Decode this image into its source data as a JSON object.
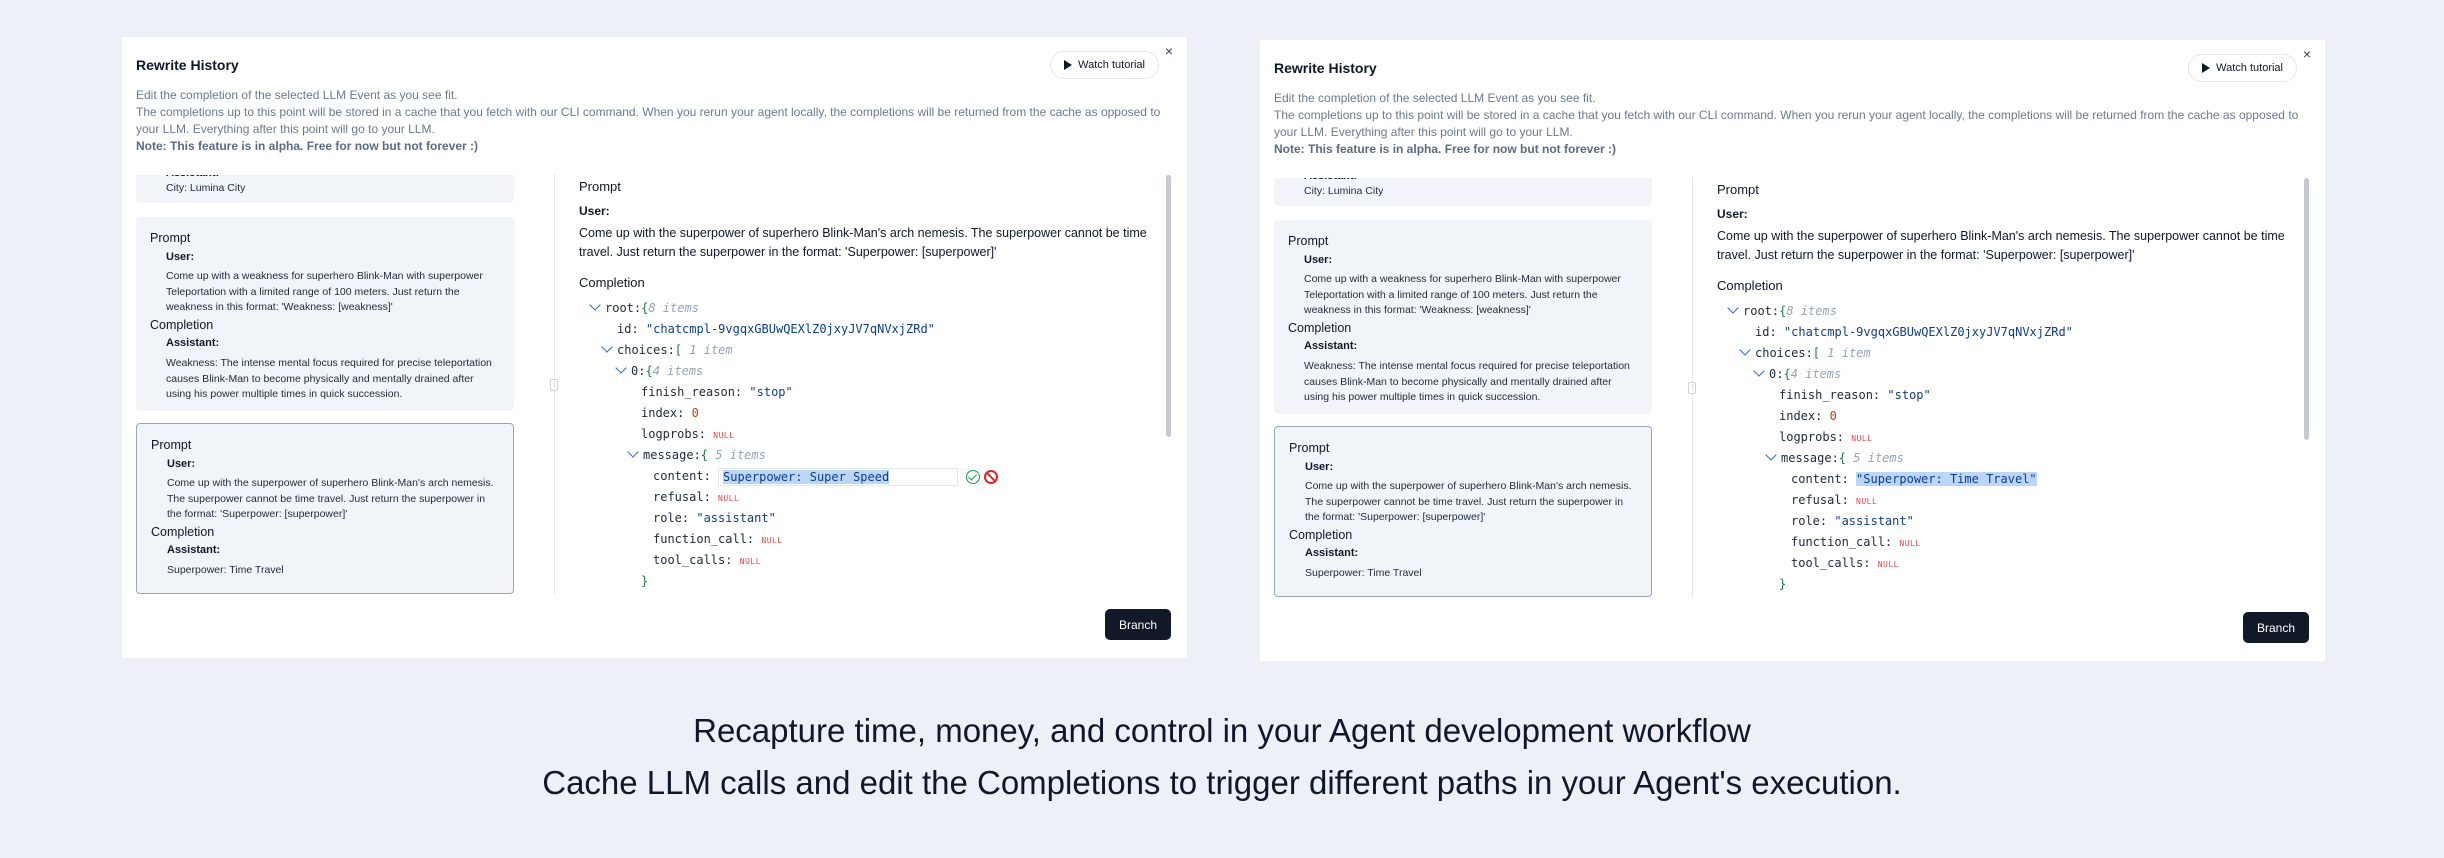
{
  "panels": [
    {
      "title": "Rewrite History",
      "tutorial_label": "Watch tutorial",
      "close_label": "×",
      "desc_line1": "Edit the completion of the selected LLM Event as you see fit.",
      "desc_line2": "The completions up to this point will be stored in a cache that you fetch with our CLI command. When you rerun your agent locally, the completions will be returned from the cache as opposed to your LLM. Everything after this point will go to your LLM.",
      "note": "Note: This feature is in alpha. Free for now but not forever :)",
      "events": {
        "ev0_role": "Assistant:",
        "ev0_text": "City: Lumina City",
        "ev1_prompt": "Prompt",
        "ev1_user": "User:",
        "ev1_user_text": "Come up with a weakness for superhero Blink-Man with superpower Teleportation with a limited range of 100 meters. Just return the weakness in this format: 'Weakness: [weakness]'",
        "ev1_completion": "Completion",
        "ev1_assistant": "Assistant:",
        "ev1_assistant_text": "Weakness: The intense mental focus required for precise teleportation causes Blink-Man to become physically and mentally drained after using his power multiple times in quick succession.",
        "ev2_prompt": "Prompt",
        "ev2_user": "User:",
        "ev2_user_text": "Come up with the superpower of superhero Blink-Man's arch nemesis. The superpower cannot be time travel. Just return the superpower in the format: 'Superpower: [superpower]'",
        "ev2_completion": "Completion",
        "ev2_assistant": "Assistant:",
        "ev2_assistant_text": "Superpower: Time Travel"
      },
      "detail": {
        "prompt_label": "Prompt",
        "user_label": "User:",
        "user_text": "Come up with the superpower of superhero Blink-Man's arch nemesis. The superpower cannot be time travel. Just return the superpower in the format: 'Superpower: [superpower]'",
        "completion_label": "Completion",
        "json": {
          "root": "root:",
          "root_count": "8 items",
          "id_key": "id:",
          "id_val": "\"chatcmpl-9vgqxGBUwQEXlZ0jxyJV7qNVxjZRd\"",
          "choices_key": "choices:",
          "choices_count": "1 item",
          "zero_key": "0:",
          "zero_count": "4 items",
          "finish_key": "finish_reason:",
          "finish_val": "\"stop\"",
          "index_key": "index:",
          "index_val": "0",
          "logprobs_key": "logprobs:",
          "null_label": "NULL",
          "message_key": "message:",
          "message_count": "5 items",
          "content_key": "content:",
          "content_val": "Superpower: Super Speed",
          "refusal_key": "refusal:",
          "role_key": "role:",
          "role_val": "\"assistant\"",
          "function_call_key": "function_call:",
          "tool_calls_key": "tool_calls:",
          "open_brace": "{",
          "open_bracket": "[",
          "close_brace": "}"
        }
      },
      "branch_label": "Branch"
    },
    {
      "title": "Rewrite History",
      "tutorial_label": "Watch tutorial",
      "close_label": "×",
      "desc_line1": "Edit the completion of the selected LLM Event as you see fit.",
      "desc_line2": "The completions up to this point will be stored in a cache that you fetch with our CLI command. When you rerun your agent locally, the completions will be returned from the cache as opposed to your LLM. Everything after this point will go to your LLM.",
      "note": "Note: This feature is in alpha. Free for now but not forever :)",
      "events": {
        "ev0_role": "Assistant:",
        "ev0_text": "City: Lumina City",
        "ev1_prompt": "Prompt",
        "ev1_user": "User:",
        "ev1_user_text": "Come up with a weakness for superhero Blink-Man with superpower Teleportation with a limited range of 100 meters. Just return the weakness in this format: 'Weakness: [weakness]'",
        "ev1_completion": "Completion",
        "ev1_assistant": "Assistant:",
        "ev1_assistant_text": "Weakness: The intense mental focus required for precise teleportation causes Blink-Man to become physically and mentally drained after using his power multiple times in quick succession.",
        "ev2_prompt": "Prompt",
        "ev2_user": "User:",
        "ev2_user_text": "Come up with the superpower of superhero Blink-Man's arch nemesis. The superpower cannot be time travel. Just return the superpower in the format: 'Superpower: [superpower]'",
        "ev2_completion": "Completion",
        "ev2_assistant": "Assistant:",
        "ev2_assistant_text": "Superpower: Time Travel"
      },
      "detail": {
        "prompt_label": "Prompt",
        "user_label": "User:",
        "user_text": "Come up with the superpower of superhero Blink-Man's arch nemesis. The superpower cannot be time travel. Just return the superpower in the format: 'Superpower: [superpower]'",
        "completion_label": "Completion",
        "json": {
          "root": "root:",
          "root_count": "8 items",
          "id_key": "id:",
          "id_val": "\"chatcmpl-9vgqxGBUwQEXlZ0jxyJV7qNVxjZRd\"",
          "choices_key": "choices:",
          "choices_count": "1 item",
          "zero_key": "0:",
          "zero_count": "4 items",
          "finish_key": "finish_reason:",
          "finish_val": "\"stop\"",
          "index_key": "index:",
          "index_val": "0",
          "logprobs_key": "logprobs:",
          "null_label": "NULL",
          "message_key": "message:",
          "message_count": "5 items",
          "content_key": "content:",
          "content_val": "\"Superpower: Time Travel\"",
          "refusal_key": "refusal:",
          "role_key": "role:",
          "role_val": "\"assistant\"",
          "function_call_key": "function_call:",
          "tool_calls_key": "tool_calls:",
          "open_brace": "{",
          "open_bracket": "[",
          "close_brace": "}"
        }
      },
      "branch_label": "Branch"
    }
  ],
  "caption": {
    "line1": "Recapture time, money, and control in your Agent development workflow",
    "line2": "Cache LLM calls and edit the Completions to trigger different paths in your Agent's execution."
  }
}
